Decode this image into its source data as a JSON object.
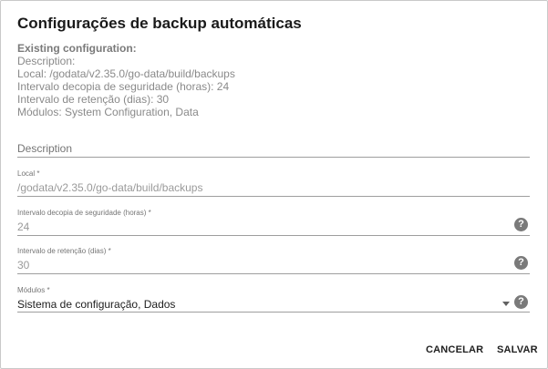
{
  "dialog": {
    "title": "Configurações de backup automáticas"
  },
  "existing": {
    "heading": "Existing configuration:",
    "lines": [
      "Description:",
      "Local: /godata/v2.35.0/go-data/build/backups",
      "Intervalo decopia de seguridade (horas): 24",
      "Intervalo de retenção (dias): 30",
      "Módulos: System Configuration, Data"
    ]
  },
  "form": {
    "description": {
      "placeholder": "Description"
    },
    "local": {
      "label": "Local *",
      "value": "/godata/v2.35.0/go-data/build/backups"
    },
    "backup_interval": {
      "label": "Intervalo decopia de seguridade (horas) *",
      "value": "24"
    },
    "retention": {
      "label": "Intervalo de retenção (dias) *",
      "value": "30"
    },
    "modules": {
      "label": "Módulos *",
      "value": "Sistema de configuração, Dados"
    },
    "help_glyph": "?"
  },
  "actions": {
    "cancel_label": "CANCELAR",
    "save_label": "SALVAR"
  },
  "icons": [
    "help-icon",
    "chevron-down-icon"
  ]
}
